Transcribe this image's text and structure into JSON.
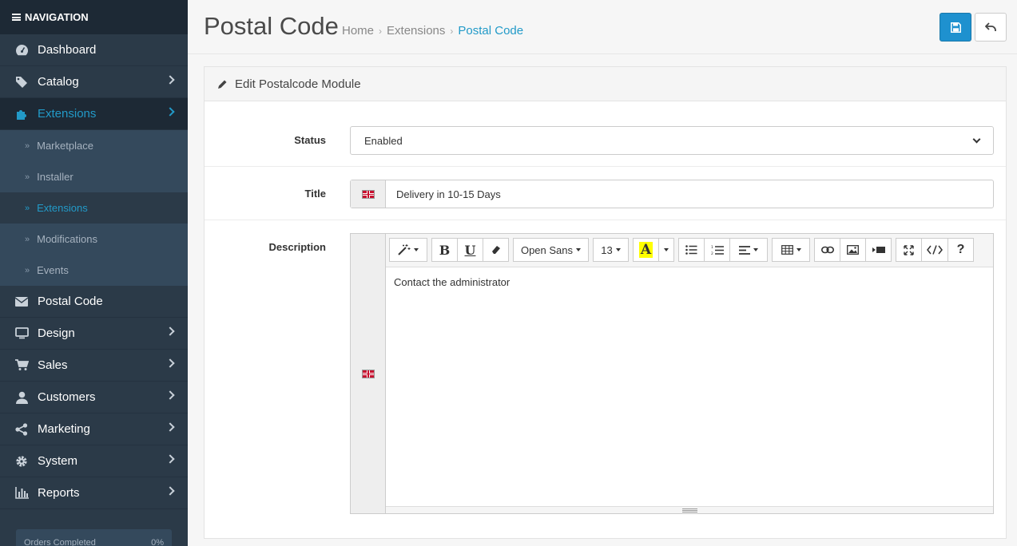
{
  "sidebar": {
    "heading": "NAVIGATION",
    "items": [
      {
        "label": "Dashboard"
      },
      {
        "label": "Catalog"
      },
      {
        "label": "Extensions"
      },
      {
        "label": "Postal Code"
      },
      {
        "label": "Design"
      },
      {
        "label": "Sales"
      },
      {
        "label": "Customers"
      },
      {
        "label": "Marketing"
      },
      {
        "label": "System"
      },
      {
        "label": "Reports"
      }
    ],
    "extensions_sub": [
      {
        "label": "Marketplace"
      },
      {
        "label": "Installer"
      },
      {
        "label": "Extensions"
      },
      {
        "label": "Modifications"
      },
      {
        "label": "Events"
      }
    ],
    "progress": {
      "label": "Orders Completed",
      "value": "0%"
    }
  },
  "header": {
    "title": "Postal Code",
    "breadcrumb": [
      "Home",
      "Extensions",
      "Postal Code"
    ]
  },
  "panel": {
    "heading": "Edit Postalcode Module",
    "status": {
      "label": "Status",
      "value": "Enabled"
    },
    "title_field": {
      "label": "Title",
      "value": "Delivery in 10-15 Days"
    },
    "description": {
      "label": "Description",
      "font": "Open Sans",
      "size": "13",
      "content": "Contact the administrator"
    }
  },
  "colors": {
    "accent": "#229ac8",
    "sidebar": "#2b3a48",
    "primary_button": "#1e91cf"
  }
}
